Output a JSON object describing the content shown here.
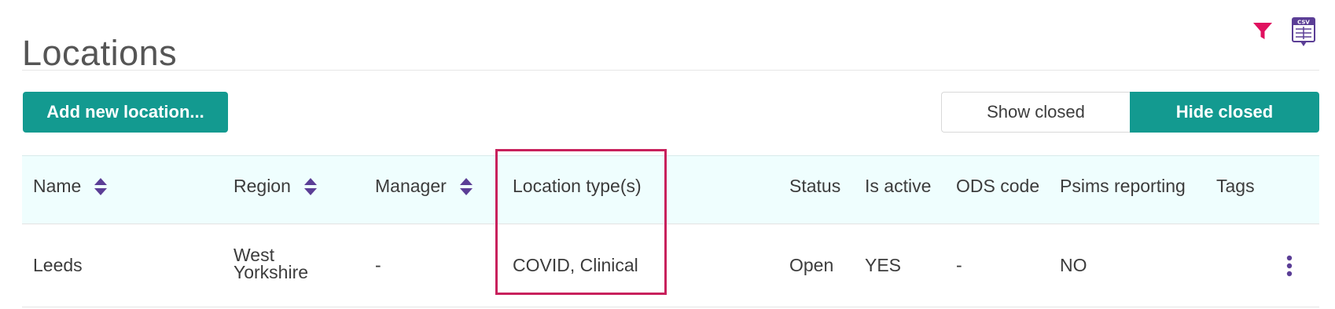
{
  "page": {
    "title": "Locations",
    "icons": {
      "filter": "filter-icon",
      "csv": "csv-export-icon",
      "csv_text": "CSV"
    },
    "colors": {
      "accent": "#139a90",
      "pink": "#e0115f",
      "purple": "#5b3e96",
      "highlight": "#c8215c"
    }
  },
  "toolbar": {
    "add_label": "Add new location...",
    "show_closed": "Show closed",
    "hide_closed": "Hide closed",
    "active_toggle": "Hide closed"
  },
  "table": {
    "headers": {
      "name": "Name",
      "region": "Region",
      "manager": "Manager",
      "location_types": "Location type(s)",
      "status": "Status",
      "is_active": "Is active",
      "ods_code": "ODS code",
      "psims_reporting": "Psims reporting",
      "tags": "Tags"
    },
    "sortable": [
      "Name",
      "Region",
      "Manager"
    ],
    "rows": [
      {
        "name": "Leeds",
        "region": "West Yorkshire",
        "manager": "-",
        "location_types": "COVID, Clinical",
        "status": "Open",
        "is_active": "YES",
        "ods_code": "-",
        "psims_reporting": "NO",
        "tags": ""
      }
    ]
  }
}
